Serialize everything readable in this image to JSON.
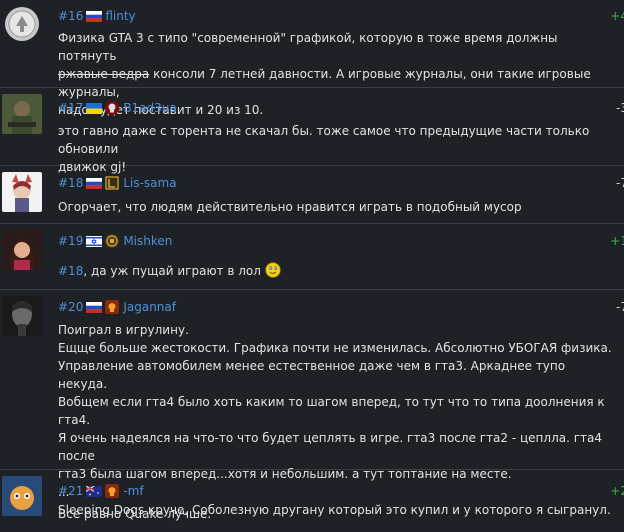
{
  "comments": [
    {
      "num": "#16",
      "nick": "flinty",
      "score": "+4",
      "lines": [
        {
          "text_before": "Физика GTA 3 с типо \"современной\" графикой, которую в тоже время должны потянуть",
          "strike": "",
          "text_after": ""
        },
        {
          "text_before": "",
          "strike": "ржавые ведра",
          "text_after": " консоли 7 летней давности. А игровые журналы, они такие игровые журналы,"
        },
        {
          "text_before": "надо будет поставит и 20 из 10.",
          "strike": "",
          "text_after": ""
        }
      ]
    },
    {
      "num": "#17",
      "nick": "B1ad3ua",
      "score": "-3",
      "lines": [
        "это гавно даже с торента не скачал бы. тоже самое что предыдущие части только обновили",
        "движок gj!"
      ]
    },
    {
      "num": "#18",
      "nick": "Lis-sama",
      "score": "-7",
      "lines": [
        "Огорчает, что людям действительно нравится играть в подобный мусор"
      ]
    },
    {
      "num": "#19",
      "nick": "Mishken",
      "score": "+1",
      "reply": "#18",
      "text": ", да уж пущай играют в лол"
    },
    {
      "num": "#20",
      "nick": "Jagannaf",
      "score": "-7",
      "lines": [
        "Поиграл в игрулину.",
        "Ещще больше жестокости. Графика почти не изменилась. Абсолютно УБОГАЯ физика.",
        "Управление автомобилем менее естественное даже чем в гта3. Аркаднее тупо некуда.",
        "Вобщем если гта4 было хоть каким то шагом вперед, то тут что то типа доолнения к гта4.",
        "Я очень надеялся на что-то что будет цеплять в игре. гта3 после гта2 - цеплла. гта4 после",
        "гта3 была шагом вперед...хотя и небольшим. а тут топтание на месте.",
        "...",
        "Sleeping Dogs круче. Соболезную другану который это купил и у которого я сыгранул."
      ]
    },
    {
      "num": "#21",
      "nick": "-mf",
      "score": "+2",
      "lines": [
        "Все равно Quake лучше."
      ]
    }
  ],
  "colors": {
    "link": "#4f8fd8",
    "positive": "#3fb04a",
    "background": "#1e2226"
  },
  "icons": {
    "flags": [
      "russia-flag",
      "ukraine-flag",
      "russia-flag",
      "israel-flag",
      "russia-flag",
      "australia-flag"
    ],
    "badges": [
      "",
      "skull-badge-icon",
      "gold-rune-badge-icon",
      "hon-badge-icon",
      "fire-skull-badge-icon",
      "fire-skull-badge-icon"
    ],
    "smiley": "smiley-icon"
  }
}
